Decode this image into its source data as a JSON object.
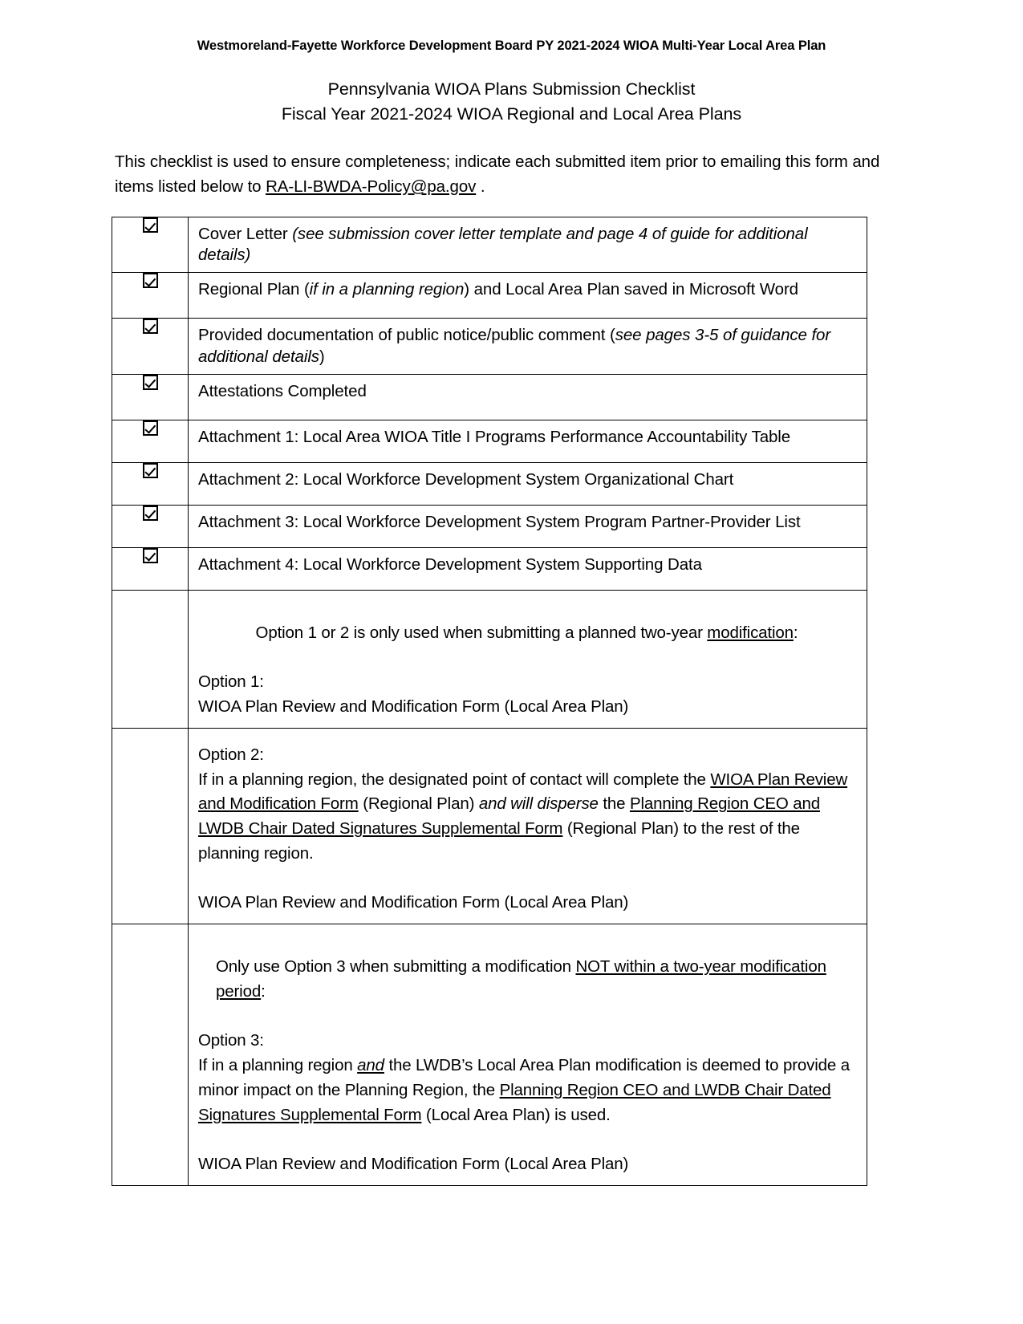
{
  "document": {
    "running_header": "Westmoreland-Fayette Workforce Development Board PY 2021-2024 WIOA Multi-Year Local Area Plan",
    "title_line1": "Pennsylvania WIOA Plans Submission Checklist",
    "title_line2": "Fiscal Year 2021-2024 WIOA Regional and Local Area Plans"
  },
  "intro": {
    "part1": "This checklist is used to ensure completeness; indicate each submitted item prior to emailing this form and items listed below to ",
    "email": "RA-LI-BWDA-Policy@pa.gov",
    "part2": " ."
  },
  "checklist": {
    "checkbox_state": "checked",
    "items": [
      {
        "checked": true,
        "plain1": "Cover Letter ",
        "italic1": "(see submission cover letter template and page 4 of guide for additional details)",
        "plain2": ""
      },
      {
        "checked": true,
        "plain1": "Regional Plan (",
        "italic1": "if in a planning region",
        "plain2": ") and Local Area Plan saved in Microsoft Word"
      },
      {
        "checked": true,
        "plain1": "Provided documentation of public notice/public comment (",
        "italic1": "see pages 3-5 of guidance for additional details",
        "plain2": ")"
      },
      {
        "checked": true,
        "plain1": "Attestations Completed",
        "italic1": "",
        "plain2": ""
      },
      {
        "checked": true,
        "plain1": "Attachment 1: Local Area WIOA Title I Programs Performance Accountability Table",
        "italic1": "",
        "plain2": ""
      },
      {
        "checked": true,
        "plain1": "Attachment 2: Local Workforce Development System Organizational Chart",
        "italic1": "",
        "plain2": ""
      },
      {
        "checked": true,
        "plain1": "Attachment 3: Local Workforce Development System Program Partner-Provider List",
        "italic1": "",
        "plain2": ""
      },
      {
        "checked": true,
        "plain1": "Attachment 4: Local Workforce Development System Supporting Data",
        "italic1": "",
        "plain2": ""
      }
    ]
  },
  "option1": {
    "lead_plain": "Option 1 or 2 is only used when submitting a planned two-year ",
    "lead_underline": "modification",
    "lead_tail": ":",
    "label": "Option 1:",
    "form_line": "WIOA Plan Review and Modification Form (Local Area Plan)"
  },
  "option2": {
    "label": "Option 2:",
    "s1": "If in a planning region, the designated point of contact will complete the ",
    "u1": "WIOA Plan Review and Modification Form",
    "s2": " (Regional Plan) ",
    "i1": "and will disperse",
    "s3": " the ",
    "u2": "Planning Region CEO and LWDB Chair Dated Signatures Supplemental Form",
    "s4": " (Regional Plan) to the rest of the planning region.",
    "form_line": "WIOA Plan Review and Modification Form (Local Area Plan)"
  },
  "option3": {
    "lead_plain": "Only use Option 3 when submitting a modification ",
    "lead_underline": "NOT within a two-year modification period",
    "lead_tail": ":",
    "label": "Option 3:",
    "s1": "If in a planning region ",
    "iu1": "and",
    "s2": " the LWDB’s Local Area Plan modification is deemed to provide a minor impact on the Planning Region, the ",
    "u1": "Planning Region CEO and LWDB Chair Dated Signatures Supplemental Form",
    "s3": " (Local Area Plan) is used.",
    "form_line": "WIOA Plan Review and Modification Form (Local Area Plan)"
  }
}
